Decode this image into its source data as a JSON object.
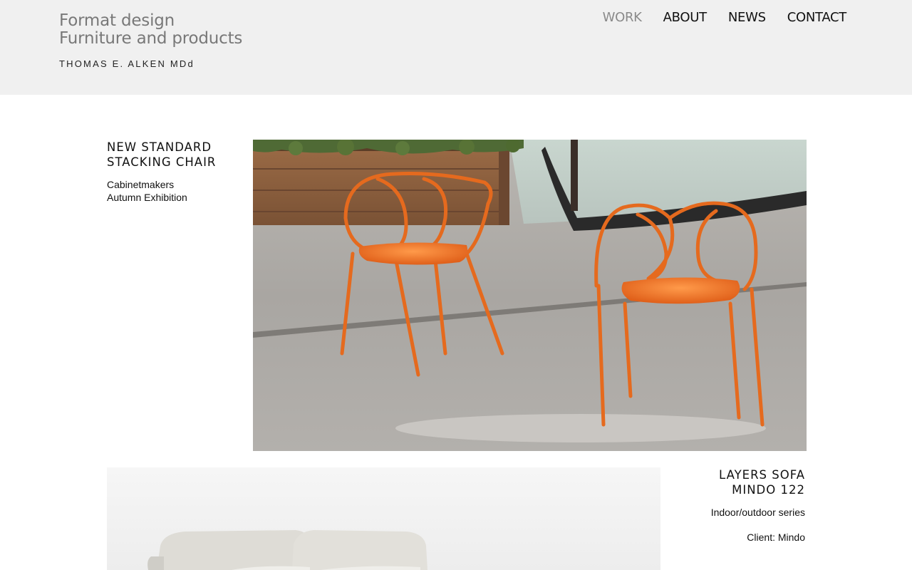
{
  "header": {
    "brand_line1": "Format design",
    "brand_line2": "Furniture and products",
    "designer": "THOMAS E. ALKEN  MDd"
  },
  "nav": {
    "items": [
      {
        "label": "WORK",
        "active": true
      },
      {
        "label": "ABOUT",
        "active": false
      },
      {
        "label": "NEWS",
        "active": false
      },
      {
        "label": "CONTACT",
        "active": false
      }
    ]
  },
  "projects": [
    {
      "title_line1": "NEW STANDARD",
      "title_line2": "STACKING CHAIR",
      "desc_line1": "Cabinetmakers",
      "desc_line2": "Autumn Exhibition",
      "image_icon": "orange-chairs-photo"
    },
    {
      "title_line1": "LAYERS SOFA",
      "title_line2": "MINDO 122",
      "desc_line1": "Indoor/outdoor series",
      "client": "Client: Mindo",
      "image_icon": "sofa-photo"
    }
  ],
  "colors": {
    "header_bg": "#f0f0f0",
    "brand_text": "#787878",
    "nav_active": "#8a8a8a",
    "chair_orange": "#e8641c"
  }
}
